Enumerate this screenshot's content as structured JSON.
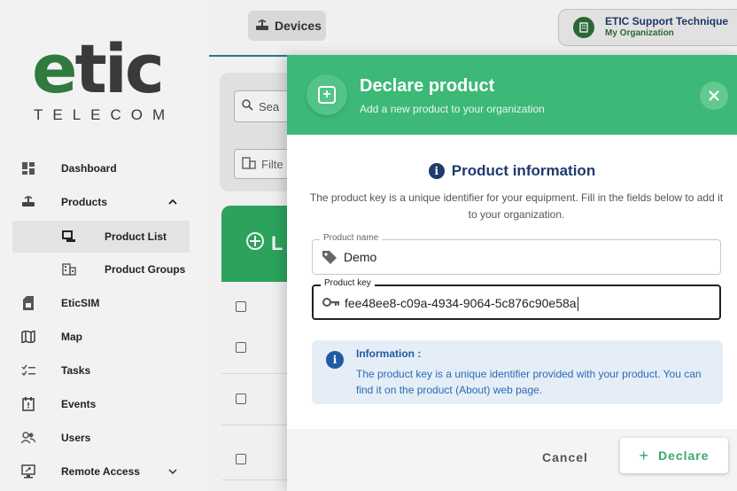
{
  "brand": {
    "word_e": "e",
    "word_rest": "tic",
    "sub": "TELECOM"
  },
  "topbar": {
    "devices_label": "Devices",
    "user_name": "ETIC Support Technique",
    "user_org": "My Organization"
  },
  "sidebar": {
    "items": [
      {
        "label": "Dashboard",
        "icon": "dashboard-icon"
      },
      {
        "label": "Products",
        "icon": "products-icon",
        "expanded": true
      },
      {
        "label": "Product List",
        "icon": "product-list-icon",
        "active": true
      },
      {
        "label": "Product Groups",
        "icon": "product-groups-icon"
      },
      {
        "label": "EticSIM",
        "icon": "sim-icon"
      },
      {
        "label": "Map",
        "icon": "map-icon"
      },
      {
        "label": "Tasks",
        "icon": "tasks-icon"
      },
      {
        "label": "Events",
        "icon": "events-icon"
      },
      {
        "label": "Users",
        "icon": "users-icon"
      },
      {
        "label": "Remote Access",
        "icon": "remote-access-icon"
      }
    ]
  },
  "background": {
    "search_placeholder": "Sea",
    "filter_label": "Filte",
    "list_title": "L"
  },
  "modal": {
    "title": "Declare product",
    "subtitle": "Add a new product to your organization",
    "section_title": "Product information",
    "section_desc": "The product key is a unique identifier for your equipment. Fill in the fields below to add it to your organization.",
    "product_name": {
      "label": "Product name",
      "value": "Demo"
    },
    "product_key": {
      "label": "Product key",
      "value": "fee48ee8-c09a-4934-9064-5c876c90e58a"
    },
    "info": {
      "title": "Information :",
      "text": "The product key is a unique identifier provided with your product. You can find it on the product (About) web page."
    },
    "cancel_label": "Cancel",
    "declare_label": "Declare"
  },
  "colors": {
    "header_green": "#3cb878",
    "accent_blue": "#1f3a6e",
    "info_blue": "#1f5aa3"
  }
}
